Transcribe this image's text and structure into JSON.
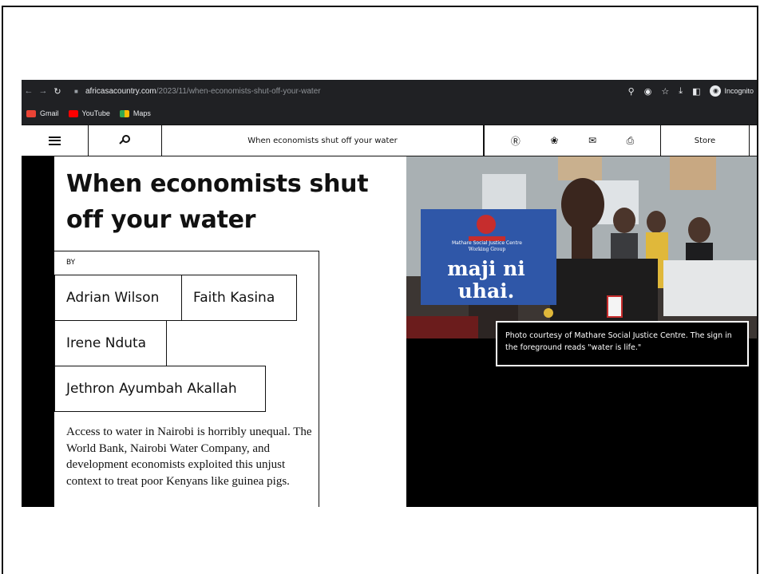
{
  "browser": {
    "url_host": "africasacountry.com",
    "url_path": "/2023/11/when-economists-shut-off-your-water",
    "profile_label": "Incognito",
    "bookmarks": [
      {
        "label": "Gmail",
        "color": "#ea4335"
      },
      {
        "label": "YouTube",
        "color": "#ff0000"
      },
      {
        "label": "Maps",
        "color": "#34a853"
      }
    ]
  },
  "site": {
    "nav_title": "When economists shut off your water",
    "store_label": "Store",
    "social_icons": [
      "facebook-icon",
      "twitter-icon",
      "mail-icon",
      "print-icon"
    ]
  },
  "article": {
    "headline": "When economists shut off your water",
    "by_label": "BY",
    "authors": [
      "Adrian Wilson",
      "Faith Kasina",
      "Irene Nduta",
      "Jethron Ayumbah Akallah"
    ],
    "summary": "Access to water in Nairobi is horribly unequal. The World Bank, Nairobi Water Company, and development economists exploited this unjust context to treat poor Kenyans like guinea pigs."
  },
  "photo": {
    "sign_org_line1": "Mathare Social Justice Centre",
    "sign_org_line2": "Working Group",
    "sign_text_line1": "maji ni",
    "sign_text_line2": "uhai.",
    "caption": "Photo courtesy of Mathare Social Justice Centre. The sign in the foreground reads \"water is life.\""
  },
  "colors": {
    "chrome": "#202124",
    "sign_blue": "#2f57a8",
    "sign_red": "#c62d2d"
  }
}
